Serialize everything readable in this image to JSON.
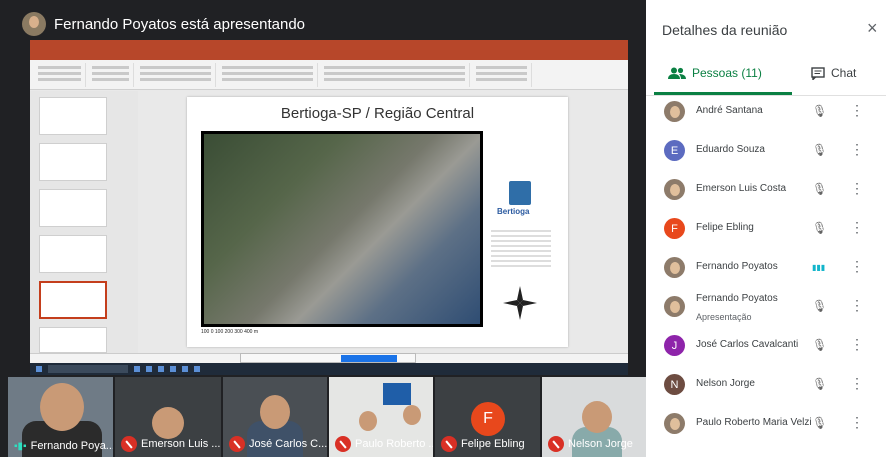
{
  "presenter": {
    "title": "Fernando Poyatos está apresentando"
  },
  "slide": {
    "title": "Bertioga-SP / Região Central",
    "brand": "Bertioga",
    "scale": "100  0   100  200  300  400 m"
  },
  "panel": {
    "title": "Detalhes da reunião",
    "close": "×",
    "tab_people": "Pessoas (11)",
    "tab_chat": "Chat",
    "people": [
      {
        "name": "André Santana",
        "sub": "",
        "initial": "",
        "color": "#8d7b6a",
        "mic": "muted"
      },
      {
        "name": "Eduardo Souza",
        "sub": "",
        "initial": "E",
        "color": "#5c6bc0",
        "mic": "muted"
      },
      {
        "name": "Emerson Luis Costa",
        "sub": "",
        "initial": "",
        "color": "#8d7b6a",
        "mic": "muted"
      },
      {
        "name": "Felipe Ebling",
        "sub": "",
        "initial": "F",
        "color": "#e8481c",
        "mic": "muted"
      },
      {
        "name": "Fernando Poyatos",
        "sub": "",
        "initial": "",
        "color": "#8d7b6a",
        "mic": "speaking"
      },
      {
        "name": "Fernando Poyatos",
        "sub": "Apresentação",
        "initial": "",
        "color": "#8d7b6a",
        "mic": "presenting"
      },
      {
        "name": "José Carlos Cavalcanti",
        "sub": "",
        "initial": "J",
        "color": "#8e24aa",
        "mic": "muted"
      },
      {
        "name": "Nelson Jorge",
        "sub": "",
        "initial": "N",
        "color": "#6d4c41",
        "mic": "muted"
      },
      {
        "name": "Paulo Roberto Maria Velzi",
        "sub": "",
        "initial": "",
        "color": "#8d7b6a",
        "mic": "muted"
      }
    ]
  },
  "tiles": [
    {
      "name": "Fernando Poya...",
      "state": "speaking"
    },
    {
      "name": "Emerson Luis ...",
      "state": "muted"
    },
    {
      "name": "José Carlos C...",
      "state": "muted"
    },
    {
      "name": "Paulo Roberto ...",
      "state": "muted"
    },
    {
      "name": "Felipe Ebling",
      "state": "muted",
      "initial": "F"
    },
    {
      "name": "Nelson Jorge",
      "state": "muted"
    }
  ]
}
